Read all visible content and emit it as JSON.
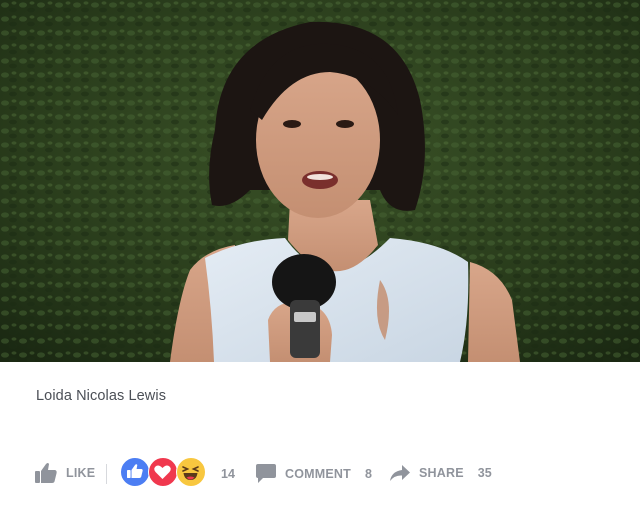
{
  "post": {
    "image_alt": "Woman with dark bob haircut in a pale blue sleeveless top speaking into a black microphone in front of a green hedge",
    "caption": "Loida Nicolas Lewis"
  },
  "actions": {
    "like_label": "LIKE",
    "reactions_count": "14",
    "reactions": [
      "like-icon",
      "love-icon",
      "haha-icon"
    ],
    "comment_label": "COMMENT",
    "comment_count": "8",
    "share_label": "SHARE",
    "share_count": "35"
  },
  "colors": {
    "like_blue": "#4c7ef3",
    "love_red": "#f0384e",
    "haha_yellow": "#f8c73f",
    "muted_gray": "#90949c"
  }
}
